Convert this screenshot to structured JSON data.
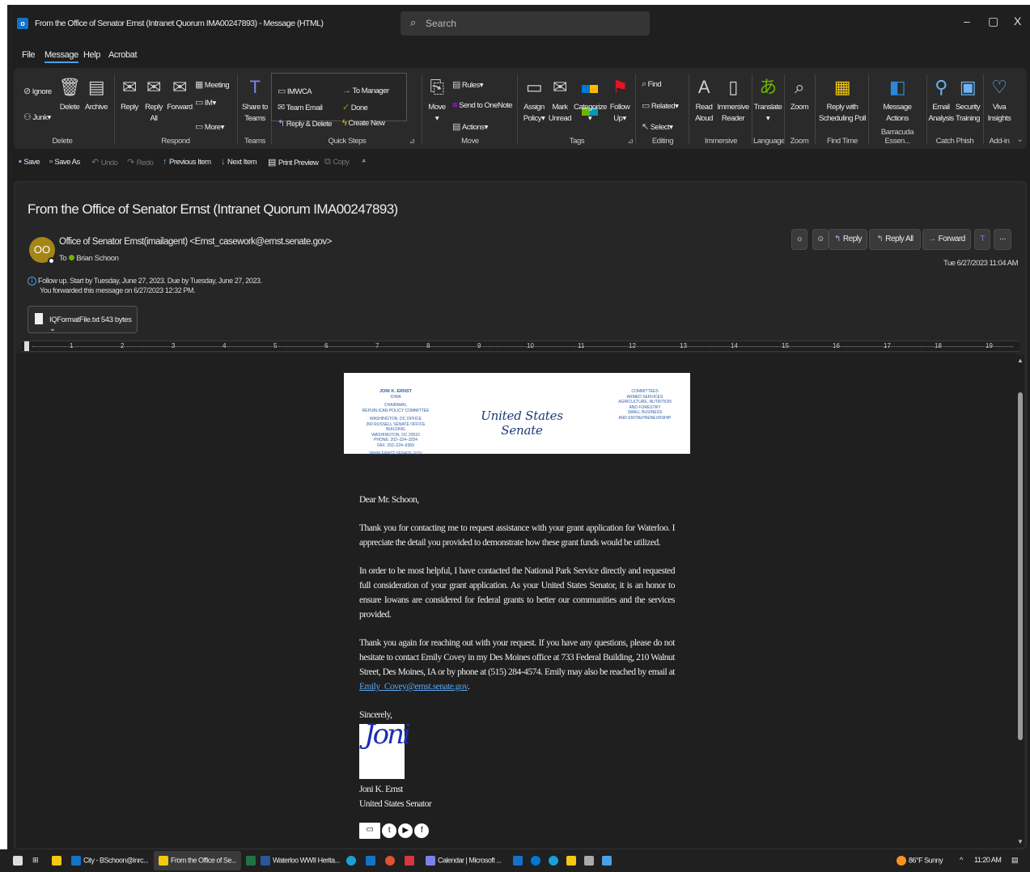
{
  "window": {
    "title": "From the Office of Senator Ernst (Intranet Quorum IMA00247893)  -  Message (HTML)",
    "search_placeholder": "Search",
    "minimize": "–",
    "restore": "▢",
    "close": "X"
  },
  "menu": [
    "File",
    "Message",
    "Help",
    "Acrobat"
  ],
  "ribbon": {
    "delete_group": {
      "label": "Delete",
      "ignore": "Ignore",
      "junk": "Junk",
      "delete": "Delete",
      "archive": "Archive"
    },
    "respond_group": {
      "label": "Respond",
      "reply": "Reply",
      "reply_all_1": "Reply",
      "reply_all_2": "All",
      "forward": "Forward",
      "meeting": "Meeting",
      "im": "IM",
      "more": "More"
    },
    "teams_group": {
      "label": "Teams",
      "share_1": "Share to",
      "share_2": "Teams"
    },
    "quicksteps_group": {
      "label": "Quick Steps",
      "imwca": "IMWCA",
      "team_email": "Team Email",
      "reply_delete": "Reply & Delete",
      "to_manager": "To Manager",
      "done": "Done",
      "create_new": "Create New"
    },
    "move_group": {
      "label": "Move",
      "move": "Move",
      "rules": "Rules",
      "onenote": "Send to OneNote",
      "actions": "Actions"
    },
    "tags_group": {
      "label": "Tags",
      "assign_1": "Assign",
      "assign_2": "Policy",
      "mark_1": "Mark",
      "mark_2": "Unread",
      "categorize": "Categorize",
      "follow_1": "Follow",
      "follow_2": "Up"
    },
    "editing_group": {
      "label": "Editing",
      "find": "Find",
      "related": "Related",
      "select": "Select"
    },
    "immersive_group": {
      "label": "Immersive",
      "read_1": "Read",
      "read_2": "Aloud",
      "imm_1": "Immersive",
      "imm_2": "Reader"
    },
    "language_group": {
      "label": "Language",
      "translate": "Translate"
    },
    "zoom_group": {
      "label": "Zoom",
      "zoom": "Zoom"
    },
    "findtime_group": {
      "label": "Find Time",
      "reply_1": "Reply with",
      "reply_2": "Scheduling Poll"
    },
    "barracuda_group": {
      "label": "Barracuda Essen...",
      "msg_1": "Message",
      "msg_2": "Actions"
    },
    "catchphish_group": {
      "label": "Catch Phish",
      "email_1": "Email",
      "email_2": "Analysis",
      "sec_1": "Security",
      "sec_2": "Training"
    },
    "addin_group": {
      "label": "Add-in",
      "viva_1": "Viva",
      "viva_2": "Insights"
    }
  },
  "qat": {
    "save": "Save",
    "save_as": "Save As",
    "undo": "Undo",
    "redo": "Redo",
    "prev": "Previous Item",
    "next": "Next Item",
    "print": "Print Preview",
    "copy": "Copy"
  },
  "message": {
    "subject": "From the Office of Senator Ernst (Intranet Quorum IMA00247893)",
    "avatar_initials": "OO",
    "sender": "Office of Senator Ernst(imailagent) <Ernst_casework@ernst.senate.gov>",
    "to_label": "To",
    "to_name": "Brian Schoon",
    "followup": "Follow up.  Start by Tuesday, June 27, 2023.  Due by Tuesday, June 27, 2023.",
    "forwarded": "You forwarded this message on 6/27/2023 12:32 PM.",
    "attachment": "IQFormatFile.txt  543 bytes",
    "date": "Tue 6/27/2023 11:04 AM",
    "actions": {
      "reply": "Reply",
      "reply_all": "Reply All",
      "forward": "Forward"
    }
  },
  "ruler": [
    "1",
    "2",
    "3",
    "4",
    "5",
    "6",
    "7",
    "8",
    "9",
    "10",
    "11",
    "12",
    "13",
    "14",
    "15",
    "16",
    "17",
    "18",
    "19"
  ],
  "letterhead": {
    "left_lines": [
      "JONI K. ERNST",
      "IOWA",
      "",
      "CHAIRMAN,",
      "REPUBLICAN POLICY COMMITTEE",
      "",
      "WASHINGTON, DC OFFICE",
      "260 RUSSELL SENATE OFFICE BUILDING",
      "WASHINGTON, DC 20510",
      "PHONE: 202–224–3254",
      "FAX: 202–224–9369",
      "",
      "WWW.ERNST.SENATE.GOV"
    ],
    "center": "United States Senate",
    "right_lines": [
      "COMMITTEES",
      "ARMED SERVICES",
      "AGRICULTURE, NUTRITION",
      "AND FORESTRY",
      "SMALL BUSINESS",
      "AND ENTREPRENEURSHIP"
    ]
  },
  "letter": {
    "salutation": "Dear Mr. Schoon,",
    "p1": "Thank you for contacting me to request assistance with your grant application for Waterloo. I appreciate the detail you provided to demonstrate how these grant funds would be utilized.",
    "p2": "In order to be most helpful, I have contacted the National Park Service directly and requested full consideration of your grant application. As your United States Senator, it is an honor to ensure Iowans are considered for federal grants to better our communities and the services provided.",
    "p3": "Thank you again for reaching out with your request. If you have any questions, please do not hesitate to contact Emily Covey in my Des Moines office at 733 Federal Building, 210 Walnut Street, Des Moines, IA or by phone at (515) 284-4574. Emily may also be reached by email at",
    "email_link": "Emily_Covey@ernst.senate.gov",
    "p3_end": ".",
    "closing": "Sincerely,",
    "signature_script": "Joni",
    "name": "Joni K. Ernst",
    "role": "United States Senator"
  },
  "taskbar": {
    "items": [
      "City - BSchoon@inrc...",
      "From the Office of Se...",
      "Waterloo WWII Herita...",
      "Calendar | Microsoft ..."
    ],
    "weather": "86°F  Sunny",
    "time": "11:20 AM"
  }
}
